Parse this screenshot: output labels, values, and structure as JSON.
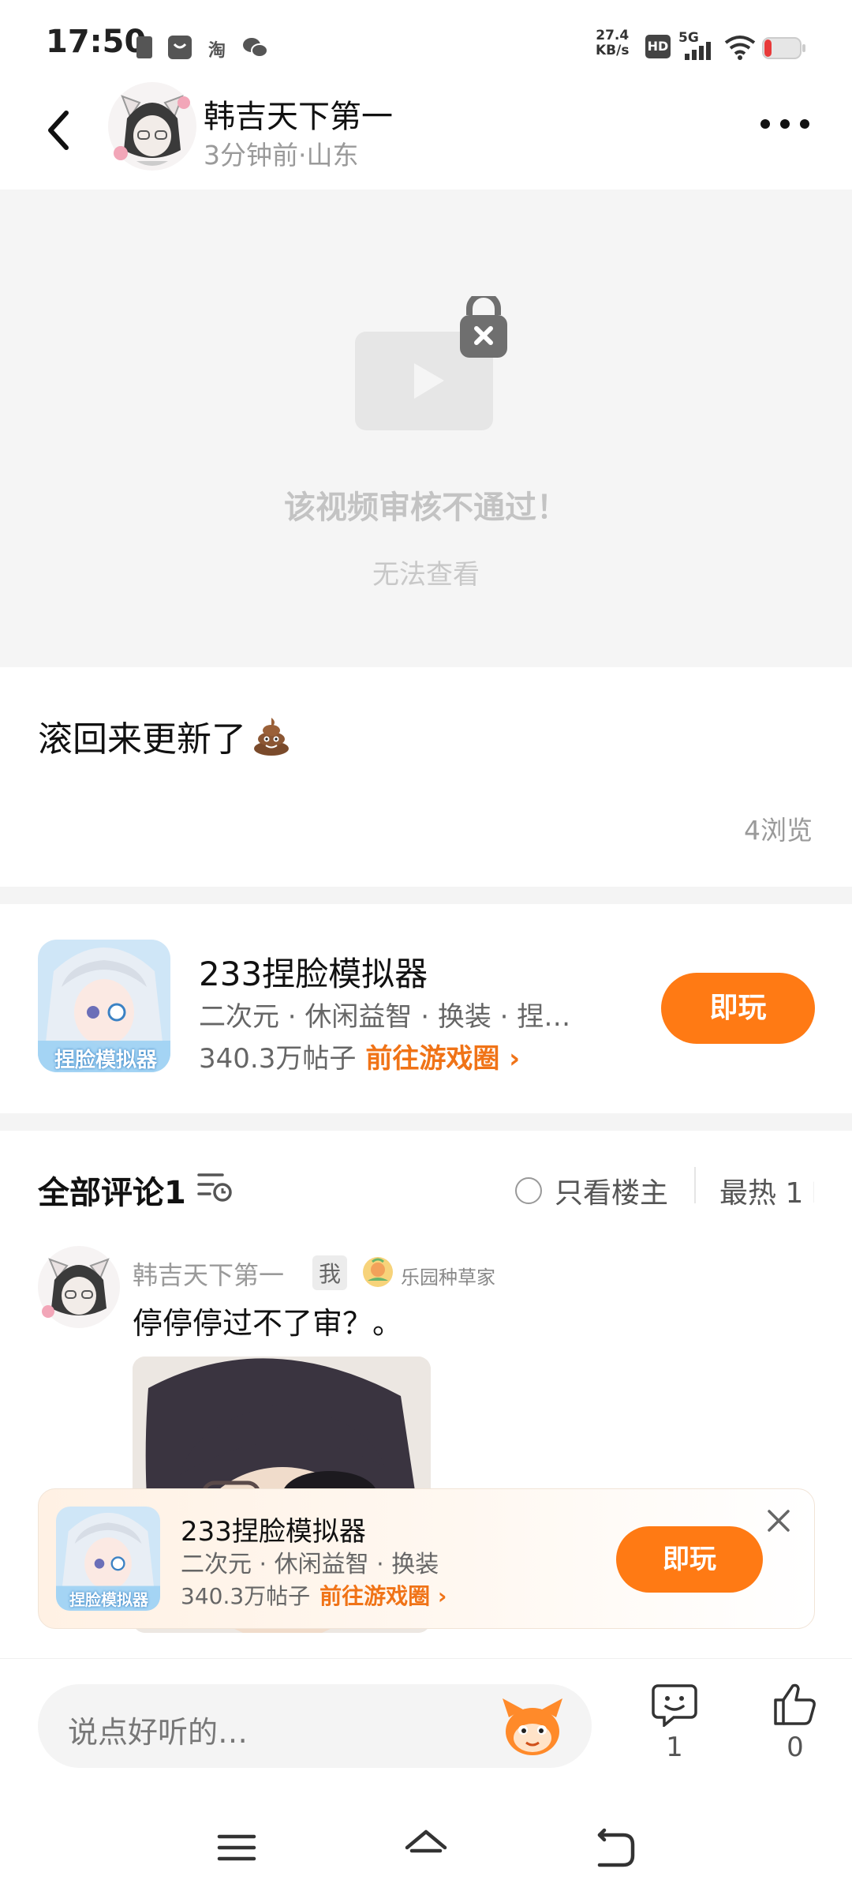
{
  "status_bar": {
    "time": "17:50",
    "net_speed_value": "27.4",
    "net_speed_unit": "KB/s",
    "hd_label": "HD",
    "signal_label": "5G",
    "notification_icons": [
      "sim-icon",
      "store-icon",
      "taobao-icon",
      "wechat-icon"
    ],
    "taobao_label": "淘"
  },
  "header": {
    "username": "韩吉天下第一",
    "meta": "3分钟前·山东"
  },
  "video": {
    "message": "该视频审核不通过！",
    "sub_message": "无法查看"
  },
  "post": {
    "text": "滚回来更新了",
    "emoji": "poop-emoji",
    "views": "4浏览"
  },
  "game_card": {
    "name": "233捏脸模拟器",
    "tags": "二次元 · 休闲益智 · 换装 · 捏…",
    "posts": "340.3万帖子",
    "link": "前往游戏圈 ›",
    "play_label": "即玩",
    "thumb_caption": "捏脸模拟器"
  },
  "comments": {
    "title": "全部评论1",
    "only_op": "只看楼主",
    "sort": "最热 1⇂",
    "items": [
      {
        "author": "韩吉天下第一",
        "badge": "我",
        "title_badge": "乐园种草家",
        "text": "停停停过不了审？。"
      }
    ]
  },
  "floating_ad": {
    "name": "233捏脸模拟器",
    "tags": "二次元 · 休闲益智 · 换装",
    "posts": "340.3万帖子",
    "link": "前往游戏圈 ›",
    "play_label": "即玩",
    "thumb_caption": "捏脸模拟器"
  },
  "bottom_bar": {
    "input_placeholder": "说点好听的…",
    "comment_count": "1",
    "like_count": "0"
  },
  "colors": {
    "accent": "#ff7a14",
    "link": "#f07317",
    "muted": "#9a9a9a"
  }
}
